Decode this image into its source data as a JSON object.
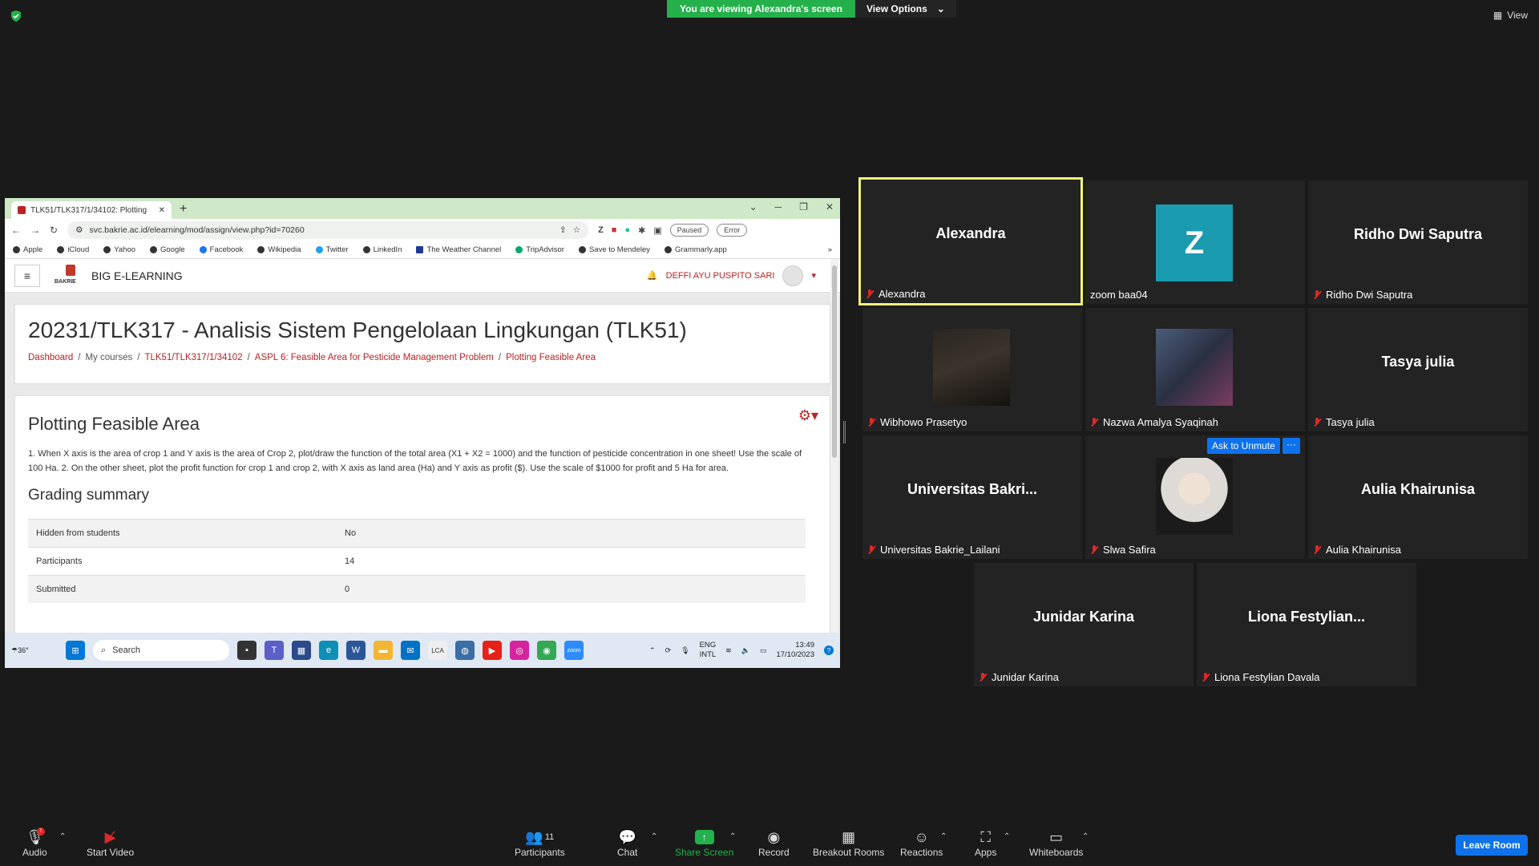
{
  "top": {
    "viewing_text": "You are viewing Alexandra's screen",
    "view_options": "View Options",
    "view_label": "View"
  },
  "browser": {
    "tab_title": "TLK51/TLK317/1/34102: Plotting",
    "url": "svc.bakrie.ac.id/elearning/mod/assign/view.php?id=70260",
    "paused_label": "Paused",
    "error_label": "Error",
    "bookmarks": [
      "Apple",
      "iCloud",
      "Yahoo",
      "Google",
      "Facebook",
      "Wikipedia",
      "Twitter",
      "LinkedIn",
      "The Weather Channel",
      "TripAdvisor",
      "Save to Mendeley",
      "Grammarly.app"
    ]
  },
  "moodle": {
    "logo_text": "BAKRIE",
    "site_name": "BIG E-LEARNING",
    "user_name": "DEFFI AYU PUSPITO SARI",
    "course_title": "20231/TLK317 - Analisis Sistem Pengelolaan Lingkungan (TLK51)",
    "breadcrumb": {
      "dashboard": "Dashboard",
      "my_courses": "My courses",
      "course": "TLK51/TLK317/1/34102",
      "section": "ASPL 6: Feasible Area for Pesticide Management Problem",
      "current": "Plotting Feasible Area"
    },
    "assignment_title": "Plotting Feasible Area",
    "intro": "1. When X axis is the area of crop 1 and Y axis is the area of Crop 2, plot/draw the function of the total area (X1 + X2 = 1000) and the function of pesticide concentration in one sheet! Use the scale of 100 Ha. 2. On the other sheet, plot the profit function for crop 1 and crop 2, with X axis as land area (Ha) and Y axis as profit ($). Use the scale of $1000 for profit and 5 Ha for area.",
    "grading_heading": "Grading summary",
    "grading_rows": [
      {
        "label": "Hidden from students",
        "value": "No"
      },
      {
        "label": "Participants",
        "value": "14"
      },
      {
        "label": "Submitted",
        "value": "0"
      }
    ]
  },
  "taskbar": {
    "temp": "36°",
    "search_placeholder": "Search",
    "lang1": "ENG",
    "lang2": "INTL",
    "time": "13:49",
    "date": "17/10/2023"
  },
  "participants": [
    {
      "display": "Alexandra",
      "name": "Alexandra"
    },
    {
      "display": "Z",
      "name": "zoom baa04"
    },
    {
      "display": "Ridho Dwi Saputra",
      "name": "Ridho Dwi Saputra"
    },
    {
      "display": "",
      "name": "Wibhowo Prasetyo"
    },
    {
      "display": "",
      "name": "Nazwa Amalya Syaqinah"
    },
    {
      "display": "Tasya julia",
      "name": "Tasya julia"
    },
    {
      "display": "Universitas  Bakri...",
      "name": "Universitas Bakrie_Lailani"
    },
    {
      "display": "",
      "name": "Slwa Safira"
    },
    {
      "display": "Aulia Khairunisa",
      "name": "Aulia Khairunisa"
    },
    {
      "display": "Junidar Karina",
      "name": "Junidar Karina"
    },
    {
      "display": "Liona  Festylian...",
      "name": "Liona Festylian Davala"
    }
  ],
  "tile_actions": {
    "ask_unmute": "Ask to Unmute",
    "more": "···"
  },
  "toolbar": {
    "audio": "Audio",
    "start_video": "Start Video",
    "participants": "Participants",
    "participants_count": "11",
    "chat": "Chat",
    "share_screen": "Share Screen",
    "record": "Record",
    "breakout_rooms": "Breakout Rooms",
    "reactions": "Reactions",
    "apps": "Apps",
    "whiteboards": "Whiteboards",
    "leave_room": "Leave Room"
  },
  "colors": {
    "share_green": "#24b04b",
    "zoom_blue": "#0e72ed",
    "active_border": "#f1f27c",
    "mute_red": "#e02828"
  }
}
